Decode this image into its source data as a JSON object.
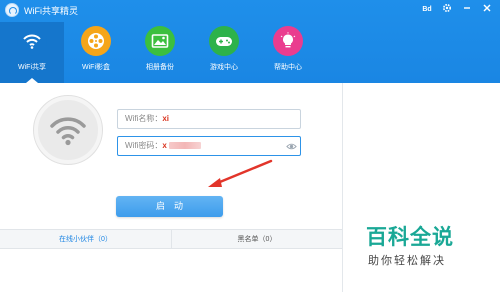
{
  "app": {
    "title": "WiFi共享精灵",
    "controls": {
      "skin_label": "Bd",
      "settings_icon": "gear-icon",
      "minimize_icon": "minimize-icon",
      "close_icon": "close-icon"
    }
  },
  "nav": {
    "items": [
      {
        "label": "WiFi共享",
        "icon": "wifi-icon",
        "color": "#1576cc",
        "active": true
      },
      {
        "label": "WiFi影盒",
        "icon": "film-reel-icon",
        "color": "#f5a519"
      },
      {
        "label": "相册备份",
        "icon": "photo-icon",
        "color": "#3cbf3e"
      },
      {
        "label": "游戏中心",
        "icon": "gamepad-icon",
        "color": "#2db24a"
      },
      {
        "label": "帮助中心",
        "icon": "lightbulb-icon",
        "color": "#ea3d8f"
      }
    ]
  },
  "form": {
    "ssid_label": "Wifi名称：",
    "ssid_value": "xi",
    "password_label": "Wifi密码：",
    "password_value": "x"
  },
  "start_button": {
    "label": "启动"
  },
  "tabs": {
    "online": "在线小伙伴（0）",
    "blacklist": "黑名单（0）"
  },
  "watermark": {
    "title": "百科全说",
    "subtitle": "助你轻松解决"
  },
  "colors": {
    "header": "#1f8fea",
    "accent": "#2d93e8",
    "arrow": "#e2352a",
    "watermark": "#1aa896"
  }
}
